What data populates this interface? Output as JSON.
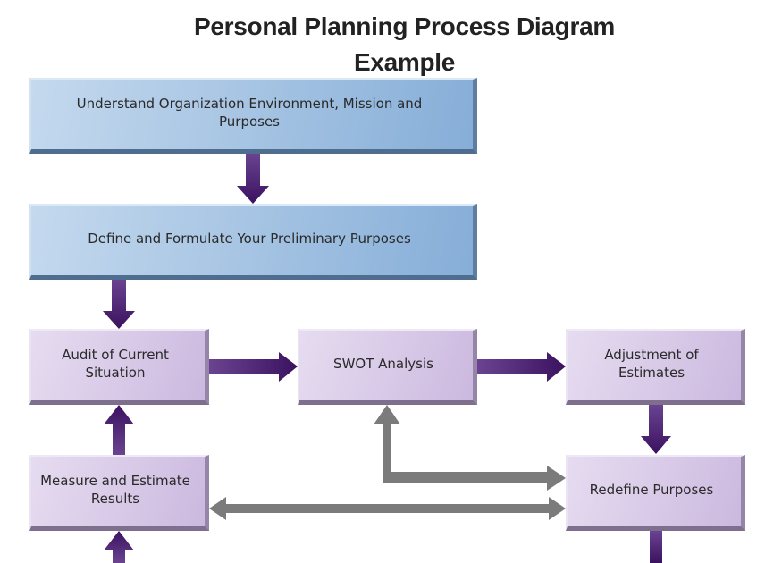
{
  "diagram": {
    "title_line1": "Personal Planning Process Diagram",
    "title_line2": "Example",
    "nodes": {
      "understand": "Understand Organization Environment, Mission and Purposes",
      "define": "Define and Formulate Your Preliminary Purposes",
      "audit": "Audit of Current Situation",
      "swot": "SWOT Analysis",
      "adjustment": "Adjustment of Estimates",
      "measure": "Measure and Estimate Results",
      "redefine": "Redefine Purposes"
    },
    "edges": [
      {
        "from": "understand",
        "to": "define",
        "style": "primary"
      },
      {
        "from": "define",
        "to": "audit",
        "style": "primary"
      },
      {
        "from": "audit",
        "to": "swot",
        "style": "primary"
      },
      {
        "from": "swot",
        "to": "adjustment",
        "style": "primary"
      },
      {
        "from": "adjustment",
        "to": "redefine",
        "style": "primary"
      },
      {
        "from": "measure",
        "to": "audit",
        "style": "primary"
      },
      {
        "from": "swot",
        "to": "redefine",
        "style": "feedback",
        "bidirectional": true
      },
      {
        "from": "measure",
        "to": "redefine",
        "style": "feedback",
        "bidirectional": true
      },
      {
        "from": "offscreen",
        "to": "measure",
        "style": "primary"
      },
      {
        "from": "redefine",
        "to": "offscreen",
        "style": "primary"
      }
    ],
    "colors": {
      "primary_arrow": "#3f1a63",
      "feedback_arrow": "#7b7b7b",
      "blue_box": "#a9c6e4",
      "purple_box": "#d9cbe8"
    }
  }
}
